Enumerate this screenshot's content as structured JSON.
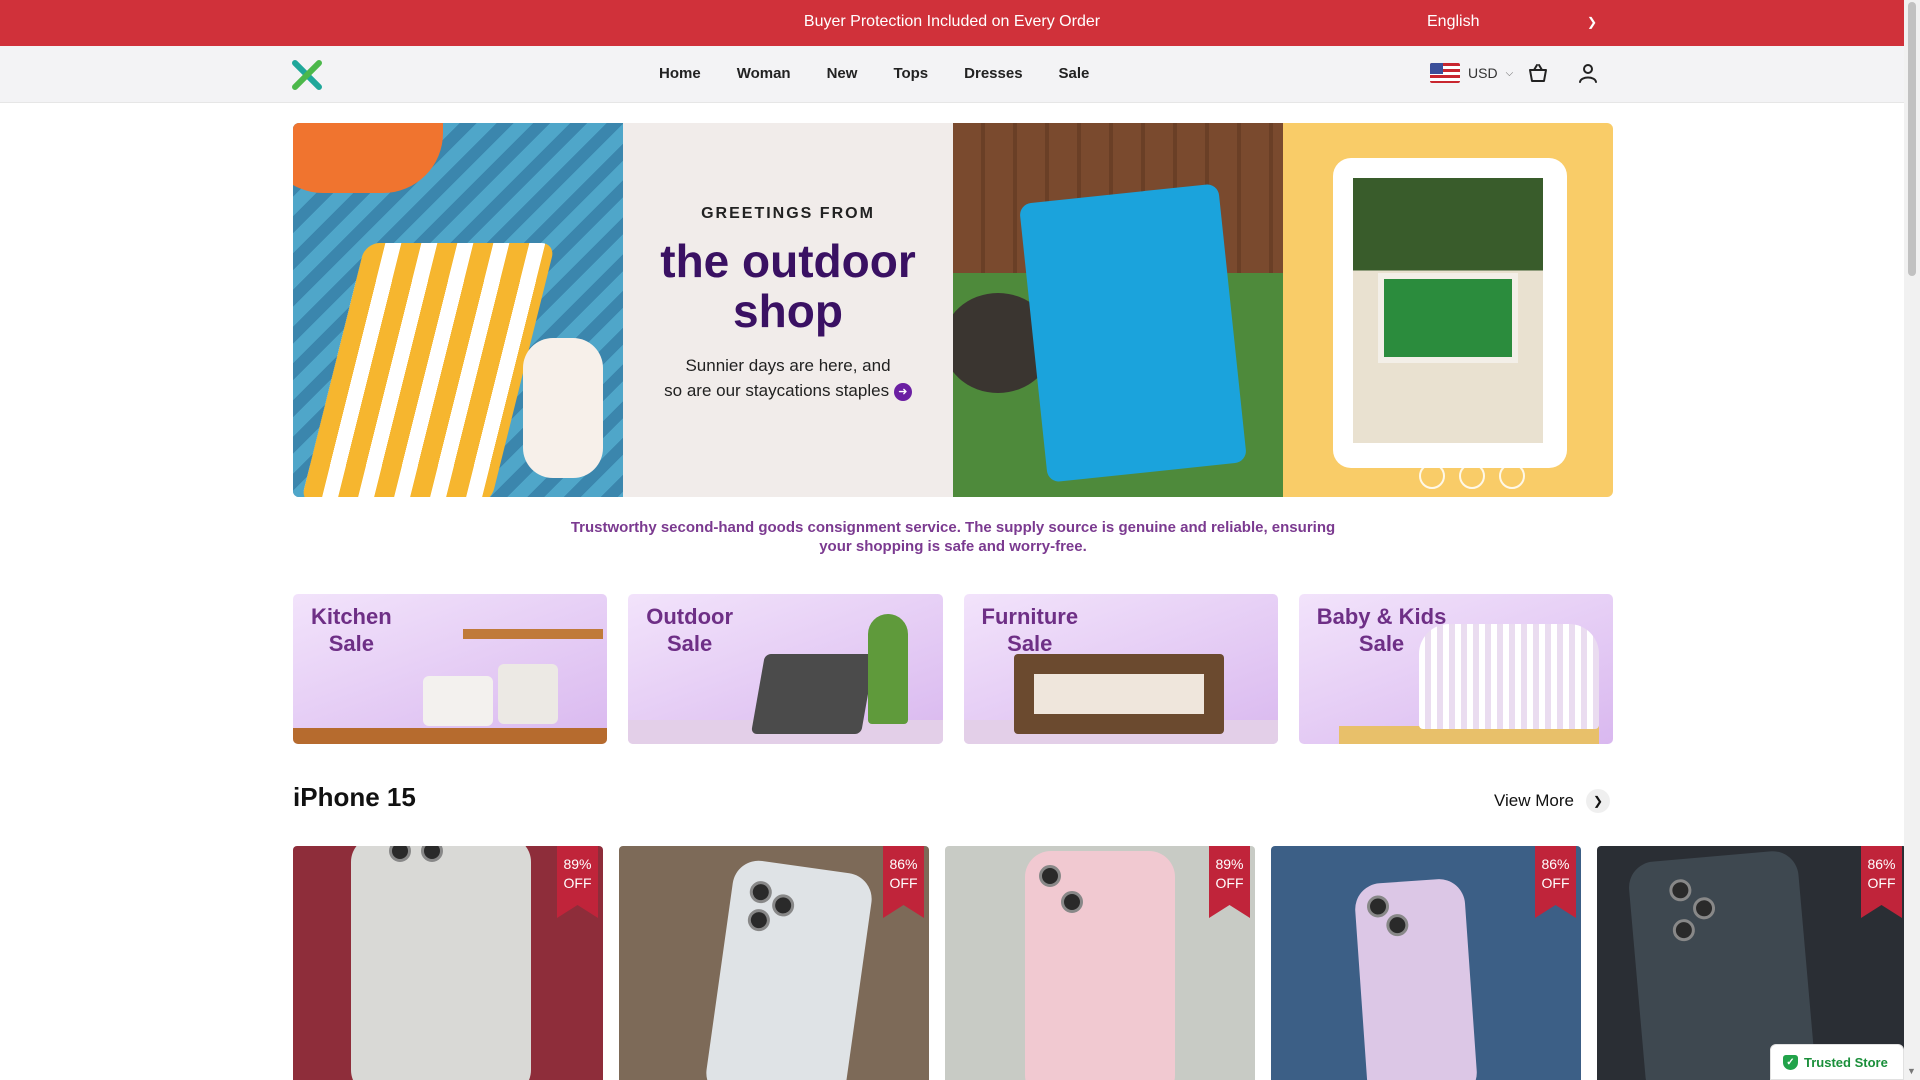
{
  "announcement": {
    "text": "Buyer Protection Included on Every Order"
  },
  "language": {
    "selected": "English"
  },
  "header": {
    "nav": [
      "Home",
      "Woman",
      "New",
      "Tops",
      "Dresses",
      "Sale"
    ],
    "currency": "USD"
  },
  "hero": {
    "greeting": "GREETINGS FROM",
    "headline_line1": "the outdoor",
    "headline_line2": "shop",
    "subtext_line1": "Sunnier days are here, and",
    "subtext_line2": "so are our staycations staples"
  },
  "tagline": {
    "line1": "Trustworthy second-hand goods consignment service. The supply source is genuine and reliable, ensuring",
    "line2": "your shopping is safe and worry-free."
  },
  "categories": [
    {
      "line1": "Kitchen",
      "line2": "Sale"
    },
    {
      "line1": "Outdoor",
      "line2": "Sale"
    },
    {
      "line1": "Furniture",
      "line2": "Sale"
    },
    {
      "line1": "Baby & Kids",
      "line2": "Sale"
    }
  ],
  "section": {
    "title": "iPhone 15",
    "view_more": "View More"
  },
  "products": [
    {
      "discount_pct": "89%",
      "off": "OFF"
    },
    {
      "discount_pct": "86%",
      "off": "OFF"
    },
    {
      "discount_pct": "89%",
      "off": "OFF"
    },
    {
      "discount_pct": "86%",
      "off": "OFF"
    },
    {
      "discount_pct": "86%",
      "off": "OFF"
    }
  ],
  "trust_badge": {
    "label": "Trusted Store"
  },
  "colors": {
    "topbar": "#d0313a",
    "headline": "#3a1163",
    "tagline": "#7b3a90",
    "badge": "#c0243a"
  }
}
